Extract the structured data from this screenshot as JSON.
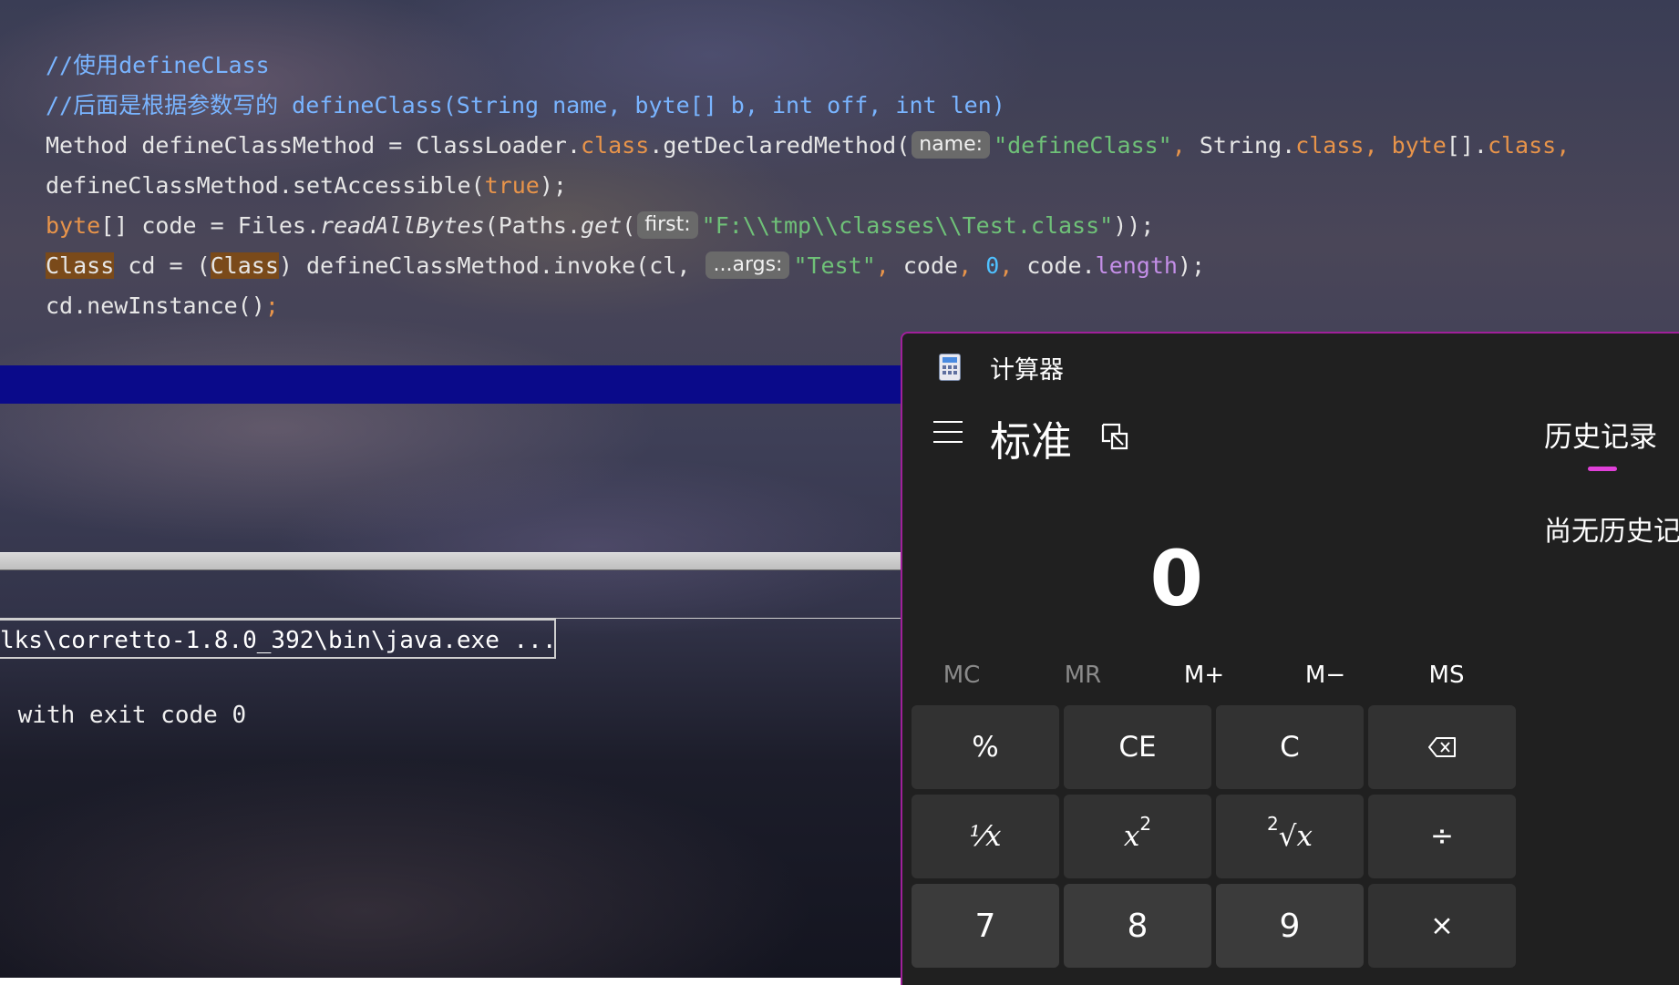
{
  "editor": {
    "lines": [
      {
        "segments": [
          {
            "t": "//使用defineCLass",
            "c": "cm"
          }
        ]
      },
      {
        "segments": [
          {
            "t": "//后面是根据参数写的 defineClass(String name, byte[] b, int off, int len)",
            "c": "cm"
          }
        ]
      },
      {
        "segments": [
          {
            "t": "Method defineClassMethod = ClassLoader."
          },
          {
            "t": "class",
            "c": "kw"
          },
          {
            "t": ".getDeclaredMethod("
          },
          {
            "hint": "name:"
          },
          {
            "t": "\"defineClass\"",
            "c": "st"
          },
          {
            "t": ", ",
            "c": "kw"
          },
          {
            "t": "String."
          },
          {
            "t": "class",
            "c": "kw"
          },
          {
            "t": ", ",
            "c": "kw"
          },
          {
            "t": "byte",
            "c": "kw"
          },
          {
            "t": "[]."
          },
          {
            "t": "class",
            "c": "kw"
          },
          {
            "t": ", ",
            "c": "kw"
          }
        ]
      },
      {
        "segments": [
          {
            "t": "defineClassMethod.setAccessible("
          },
          {
            "t": "true",
            "c": "kw"
          },
          {
            "t": ");"
          },
          {
            "t": "",
            "c": "kw"
          }
        ]
      },
      {
        "segments": [
          {
            "t": "byte",
            "c": "kw"
          },
          {
            "t": "[] code = Files."
          },
          {
            "t": "readAllBytes",
            "c": "it"
          },
          {
            "t": "(Paths."
          },
          {
            "t": "get",
            "c": "it"
          },
          {
            "t": "("
          },
          {
            "hint": "first:"
          },
          {
            "t": "\"F:\\\\tmp\\\\classes\\\\Test.class\"",
            "c": "st"
          },
          {
            "t": "));"
          }
        ]
      },
      {
        "segments": [
          {
            "t": "Class",
            "c": "hl"
          },
          {
            "t": " cd = ("
          },
          {
            "t": "Class",
            "c": "hl"
          },
          {
            "t": ") defineClassMethod.invoke(cl, "
          },
          {
            "hint": "...args:"
          },
          {
            "t": "\"Test\"",
            "c": "st"
          },
          {
            "t": ", ",
            "c": "kw"
          },
          {
            "t": "code"
          },
          {
            "t": ", ",
            "c": "kw"
          },
          {
            "t": "0",
            "c": "nm"
          },
          {
            "t": ", ",
            "c": "kw"
          },
          {
            "t": "code."
          },
          {
            "t": "length",
            "c": "fld"
          },
          {
            "t": ");"
          }
        ]
      },
      {
        "segments": [
          {
            "t": "cd.newInstance()"
          },
          {
            "t": ";",
            "c": "kw"
          }
        ]
      }
    ]
  },
  "run_console": {
    "command_text": "lks\\corretto-1.8.0_392\\bin\\java.exe ...",
    "exit_text": " with exit code 0"
  },
  "calculator": {
    "window_title": "计算器",
    "app_icon": "calculator-icon",
    "menu_icon": "hamburger-menu-icon",
    "mode_label": "标准",
    "keep_on_top_icon": "keep-on-top-icon",
    "history_tab_label": "历史记录",
    "history_empty_text": "尚无历史记录",
    "accent_color": "#e040d8",
    "display_value": "0",
    "memory_buttons": [
      {
        "label": "MC",
        "enabled": false
      },
      {
        "label": "MR",
        "enabled": false
      },
      {
        "label": "M+",
        "enabled": true
      },
      {
        "label": "M−",
        "enabled": true
      },
      {
        "label": "MS",
        "enabled": true
      }
    ],
    "keys": {
      "percent": "%",
      "clear_entry": "CE",
      "clear": "C",
      "backspace_icon": "backspace-icon",
      "reciprocal": "⅟x",
      "square_base": "x",
      "square_exp": "2",
      "sqrt_index": "2",
      "sqrt_body": "√x",
      "divide": "÷",
      "seven": "7",
      "eight": "8",
      "nine": "9",
      "multiply": "×"
    }
  }
}
